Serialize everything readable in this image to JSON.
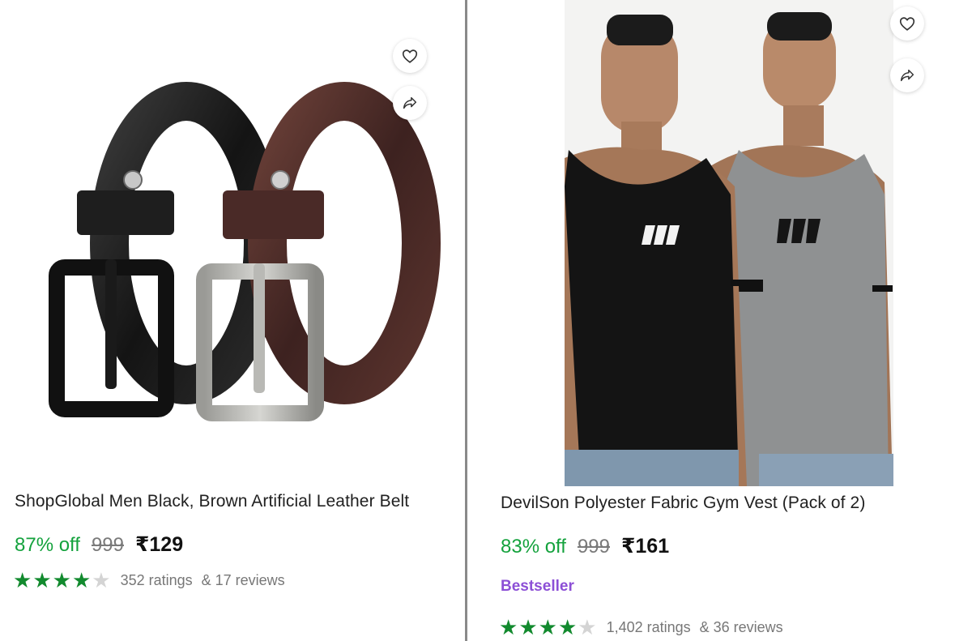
{
  "products": [
    {
      "title": "ShopGlobal Men Black, Brown Artificial Leather Belt",
      "discount": "87% off",
      "mrp": "999",
      "price": "₹129",
      "rating_stars": 4,
      "ratings_text": "352 ratings",
      "reviews_text": "& 17 reviews",
      "image": "belt-pair-image",
      "badge": ""
    },
    {
      "title": "DevilSon Polyester Fabric Gym Vest (Pack of 2)",
      "discount": "83% off",
      "mrp": "999",
      "price": "₹161",
      "badge": "Bestseller",
      "rating_stars": 4,
      "ratings_text": "1,402 ratings",
      "reviews_text": "& 36 reviews",
      "image": "gym-vest-models-image"
    }
  ],
  "icons": {
    "wishlist": "heart-icon",
    "share": "share-icon",
    "star": "star-icon"
  },
  "colors": {
    "discount": "#14a23d",
    "star": "#128a2e",
    "badge": "#8c4fd6",
    "divider": "#8a8a8a"
  }
}
